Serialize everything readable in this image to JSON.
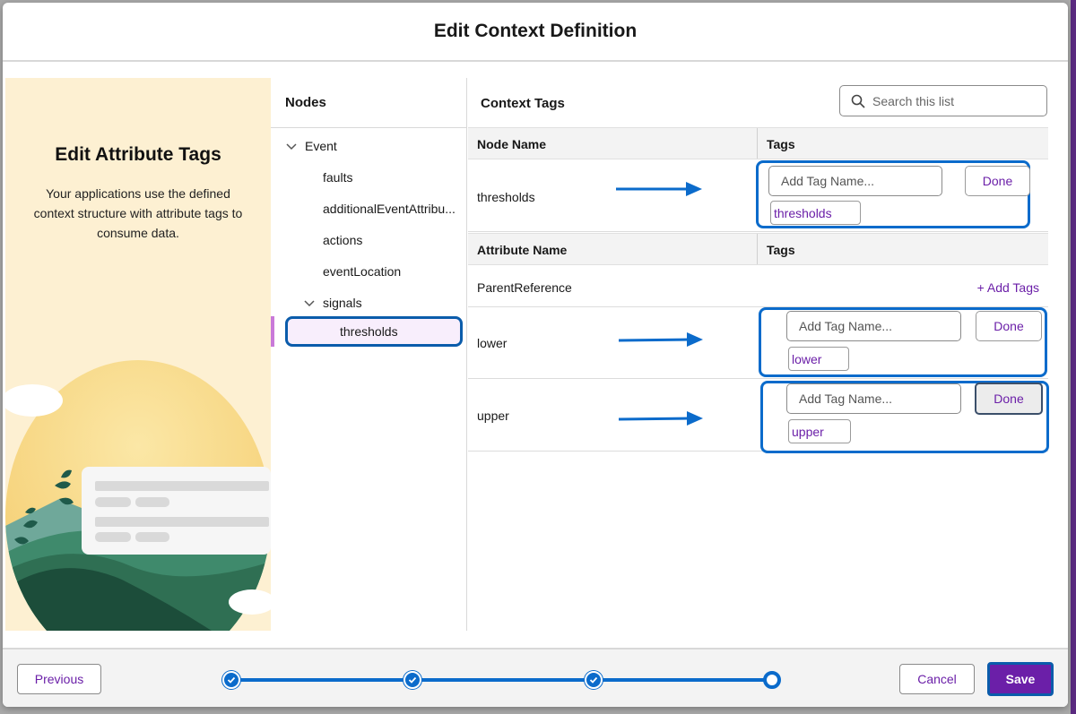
{
  "modal": {
    "title": "Edit Context Definition"
  },
  "illustration": {
    "title": "Edit Attribute Tags",
    "description": "Your applications use the defined context structure with attribute tags to consume data."
  },
  "nodes": {
    "heading": "Nodes",
    "items": [
      {
        "label": "Event",
        "expanded": true
      },
      {
        "label": "faults"
      },
      {
        "label": "additionalEventAttribu..."
      },
      {
        "label": "actions"
      },
      {
        "label": "eventLocation"
      },
      {
        "label": "signals",
        "expanded": true
      },
      {
        "label": "thresholds",
        "selected": true
      }
    ]
  },
  "context_tags": {
    "title": "Context Tags",
    "search_placeholder": "Search this list",
    "node_table": {
      "col_name": "Node Name",
      "col_tags": "Tags",
      "row": {
        "name": "thresholds",
        "input_placeholder": "Add Tag Name...",
        "done_label": "Done",
        "tag": "thresholds"
      }
    },
    "attr_table": {
      "col_name": "Attribute Name",
      "col_tags": "Tags",
      "rows": [
        {
          "name": "ParentReference",
          "add_tags_label": "+ Add Tags"
        },
        {
          "name": "lower",
          "input_placeholder": "Add Tag Name...",
          "done_label": "Done",
          "tag": "lower"
        },
        {
          "name": "upper",
          "input_placeholder": "Add Tag Name...",
          "done_label": "Done",
          "tag": "upper"
        }
      ]
    }
  },
  "footer": {
    "previous_label": "Previous",
    "cancel_label": "Cancel",
    "save_label": "Save",
    "steps": {
      "total": 4,
      "current": 4
    }
  },
  "colors": {
    "brand": "#6b1fa8",
    "accent_blue": "#0b6bcb",
    "illustration_bg": "#fdf0d2"
  }
}
